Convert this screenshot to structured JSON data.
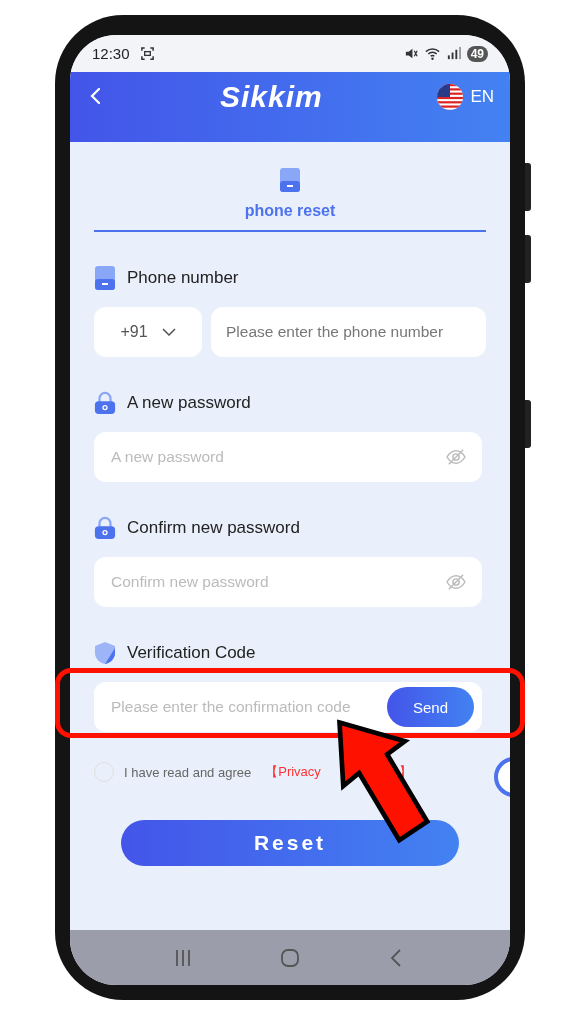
{
  "status_bar": {
    "time": "12:30",
    "battery": "49"
  },
  "header": {
    "logo": "Sikkim",
    "language": "EN"
  },
  "tab": {
    "label": "phone reset",
    "selected": true
  },
  "fields": [
    {
      "kind": "phone",
      "label": "Phone number",
      "country_code": "+91",
      "placeholder": "Please enter the phone number"
    },
    {
      "kind": "password",
      "label": "A new password",
      "placeholder": "A new password"
    },
    {
      "kind": "password",
      "label": "Confirm new password",
      "placeholder": "Confirm new password"
    },
    {
      "kind": "code",
      "label": "Verification Code",
      "placeholder": "Please enter the confirmation code",
      "button": "Send"
    }
  ],
  "agreement": {
    "checked": false,
    "text": "I have read and agree",
    "link": "【Privacy",
    "link_end": "】"
  },
  "reset_button": "Reset"
}
